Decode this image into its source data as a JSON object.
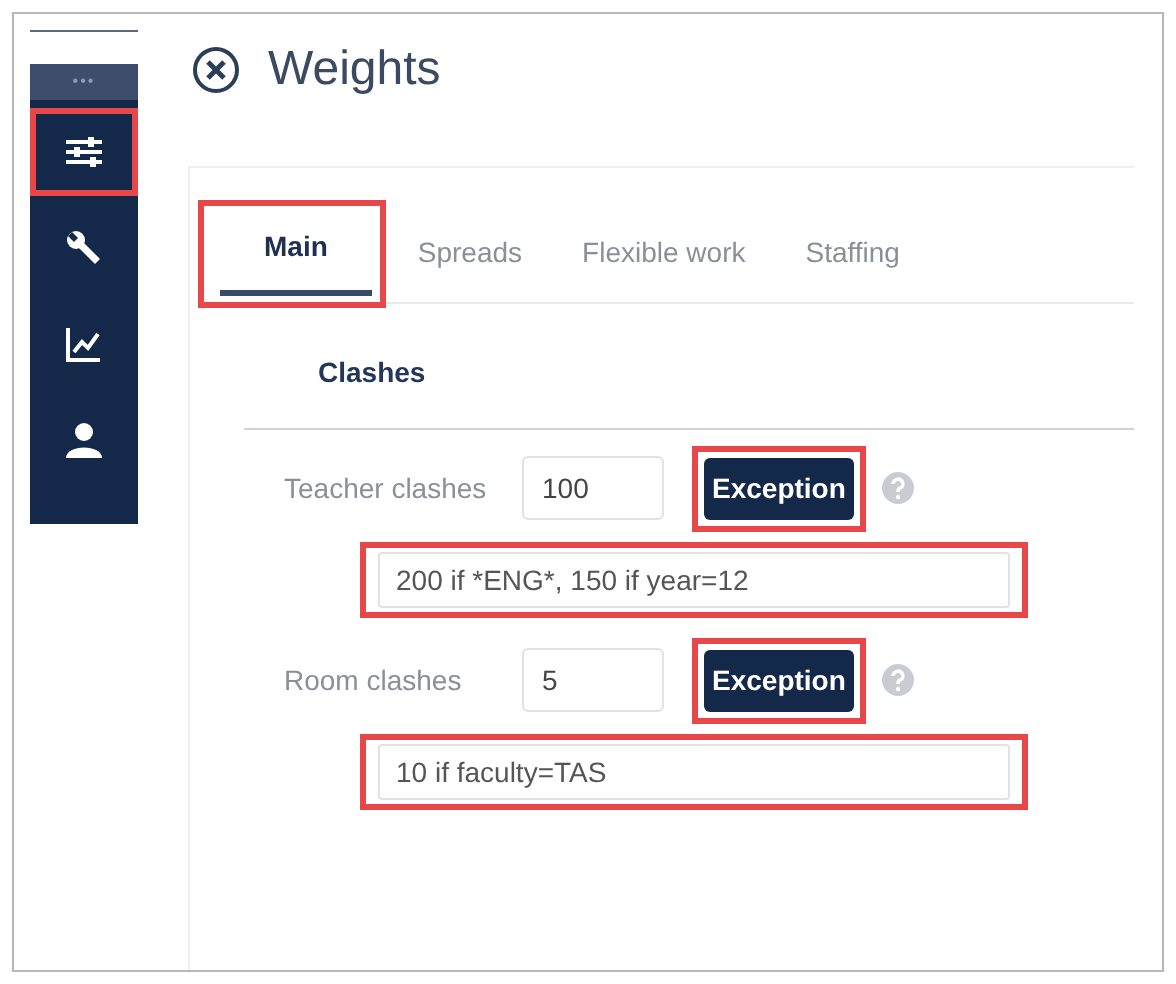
{
  "sidebar": {
    "more": "•••",
    "items": [
      {
        "kind": "sliders",
        "highlighted": true
      },
      {
        "kind": "wrench",
        "highlighted": false
      },
      {
        "kind": "chart",
        "highlighted": false
      },
      {
        "kind": "person",
        "highlighted": false
      }
    ]
  },
  "window": {
    "title": "Weights"
  },
  "tabs": [
    {
      "label": "Main",
      "selected": true,
      "highlighted": true
    },
    {
      "label": "Spreads",
      "selected": false,
      "highlighted": false
    },
    {
      "label": "Flexible work",
      "selected": false,
      "highlighted": false
    },
    {
      "label": "Staffing",
      "selected": false,
      "highlighted": false
    }
  ],
  "section": {
    "title": "Clashes"
  },
  "rows": [
    {
      "label": "Teacher clashes",
      "value": "100",
      "button": "Exception",
      "exception": "200 if *ENG*, 150 if year=12",
      "highlighted": true
    },
    {
      "label": "Room clashes",
      "value": "5",
      "button": "Exception",
      "exception": "10 if faculty=TAS",
      "highlighted": true
    }
  ]
}
